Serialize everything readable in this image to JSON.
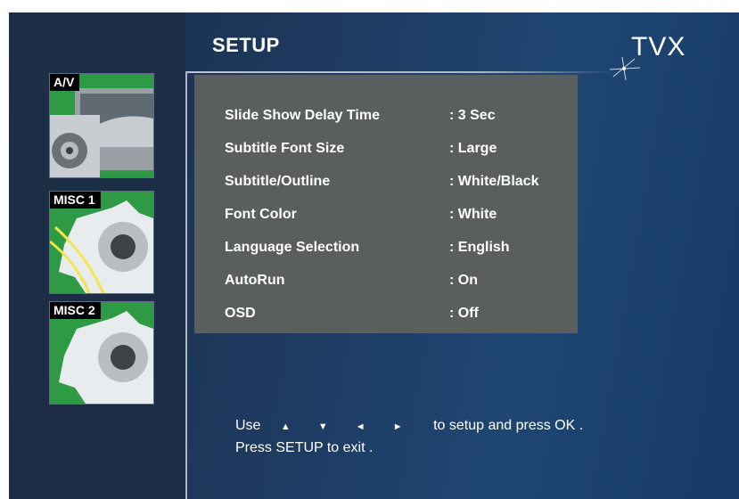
{
  "header": {
    "title": "SETUP",
    "logo_text": "TVX"
  },
  "sidebar": {
    "tabs": [
      {
        "label": "A/V"
      },
      {
        "label": "MISC 1"
      },
      {
        "label": "MISC 2"
      }
    ]
  },
  "settings": [
    {
      "label": "Slide Show Delay Time",
      "value": ": 3 Sec"
    },
    {
      "label": "Subtitle Font Size",
      "value": ": Large"
    },
    {
      "label": "Subtitle/Outline",
      "value": ": White/Black"
    },
    {
      "label": "Font Color",
      "value": ": White"
    },
    {
      "label": "Language Selection",
      "value": ": English"
    },
    {
      "label": "AutoRun",
      "value": ": On"
    },
    {
      "label": "OSD",
      "value": ": Off"
    }
  ],
  "help": {
    "line1_prefix": "Use",
    "arrows": "▲ ▼ ◄ ►",
    "line1_suffix": "to setup and press OK .",
    "line2": "Press SETUP to exit ."
  },
  "colors": {
    "background": "#1e3a5f",
    "panel": "#5b5e5f",
    "thumb_green": "#2e9a43"
  }
}
